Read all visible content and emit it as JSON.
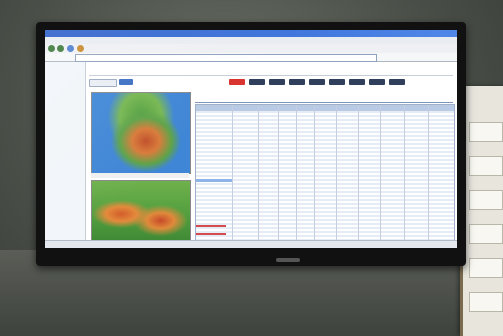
{
  "scene": {
    "description_colors": {
      "bezel": "#111111",
      "screen_bg": "#dfe6ee",
      "title_bar": "#2c5fc9",
      "map_sea": "#3f86d6",
      "map_land": "#5ea348",
      "map_hot": "#c0502a",
      "table_row_alt": "#e6ecf5"
    }
  },
  "icons": [
    "browser-back-icon",
    "browser-forward-icon",
    "refresh-icon",
    "home-icon"
  ]
}
